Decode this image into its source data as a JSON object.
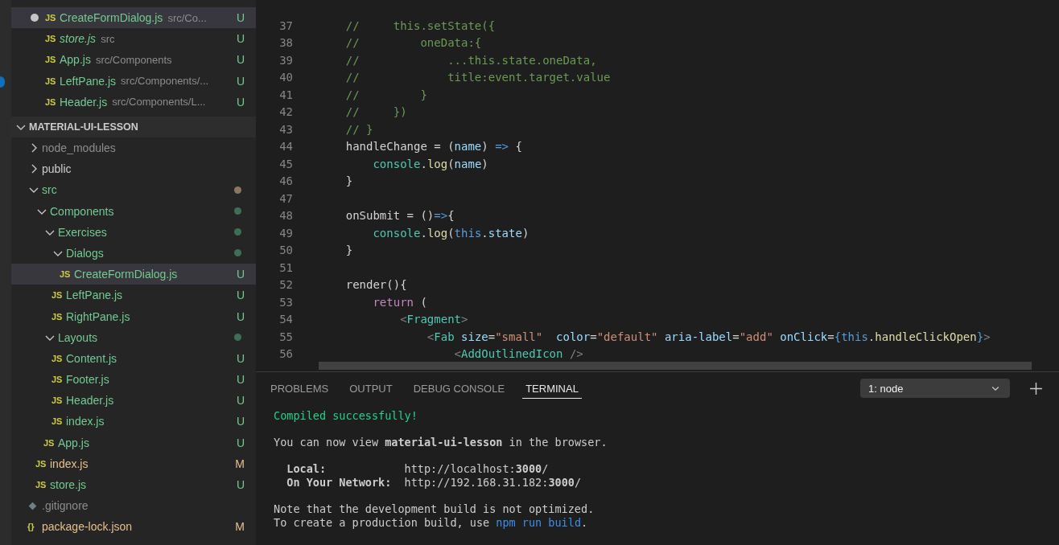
{
  "open_editors": [
    {
      "name": "CreateFormDialog.js",
      "path": "src/Co...",
      "icon": "JS",
      "status": "U",
      "unsaved": true,
      "preview": false,
      "selected": true
    },
    {
      "name": "store.js",
      "path": "src",
      "icon": "JS",
      "status": "U",
      "unsaved": false,
      "preview": true,
      "selected": false
    },
    {
      "name": "App.js",
      "path": "src/Components",
      "icon": "JS",
      "status": "U",
      "unsaved": false,
      "preview": false,
      "selected": false
    },
    {
      "name": "LeftPane.js",
      "path": "src/Components/...",
      "icon": "JS",
      "status": "U",
      "unsaved": false,
      "preview": false,
      "selected": false
    },
    {
      "name": "Header.js",
      "path": "src/Components/L...",
      "icon": "JS",
      "status": "U",
      "unsaved": false,
      "preview": false,
      "selected": false
    }
  ],
  "explorer": {
    "title": "MATERIAL-UI-LESSON",
    "expanded": true,
    "children": [
      {
        "kind": "folder",
        "name": "node_modules",
        "expanded": false,
        "ignored": true,
        "selected": false
      },
      {
        "kind": "folder",
        "name": "public",
        "expanded": false,
        "ignored": false,
        "selected": false
      },
      {
        "kind": "folder",
        "name": "src",
        "expanded": true,
        "color": "#8a7760",
        "ignored": false,
        "selected": false,
        "children": [
          {
            "kind": "folder",
            "name": "Components",
            "expanded": true,
            "color": "#3f6e58",
            "ignored": false,
            "selected": false,
            "children": [
              {
                "kind": "folder",
                "name": "Exercises",
                "expanded": true,
                "color": "#3f6e58",
                "ignored": false,
                "selected": false,
                "children": [
                  {
                    "kind": "folder",
                    "name": "Dialogs",
                    "expanded": true,
                    "color": "#3f6e58",
                    "ignored": false,
                    "selected": false,
                    "children": [
                      {
                        "kind": "file",
                        "name": "CreateFormDialog.js",
                        "icon": "JS",
                        "status": "U",
                        "ignored": false,
                        "selected": true
                      }
                    ]
                  },
                  {
                    "kind": "file",
                    "name": "LeftPane.js",
                    "icon": "JS",
                    "status": "U",
                    "ignored": false,
                    "selected": false
                  },
                  {
                    "kind": "file",
                    "name": "RightPane.js",
                    "icon": "JS",
                    "status": "U",
                    "ignored": false,
                    "selected": false
                  }
                ]
              },
              {
                "kind": "folder",
                "name": "Layouts",
                "expanded": true,
                "color": "#3f6e58",
                "ignored": false,
                "selected": false,
                "children": [
                  {
                    "kind": "file",
                    "name": "Content.js",
                    "icon": "JS",
                    "status": "U",
                    "ignored": false,
                    "selected": false
                  },
                  {
                    "kind": "file",
                    "name": "Footer.js",
                    "icon": "JS",
                    "status": "U",
                    "ignored": false,
                    "selected": false
                  },
                  {
                    "kind": "file",
                    "name": "Header.js",
                    "icon": "JS",
                    "status": "U",
                    "ignored": false,
                    "selected": false
                  },
                  {
                    "kind": "file",
                    "name": "index.js",
                    "icon": "JS",
                    "status": "U",
                    "ignored": false,
                    "selected": false
                  }
                ]
              },
              {
                "kind": "file",
                "name": "App.js",
                "icon": "JS",
                "status": "U",
                "ignored": false,
                "selected": false
              }
            ]
          },
          {
            "kind": "file",
            "name": "index.js",
            "icon": "JS",
            "status": "M",
            "ignored": false,
            "selected": false
          },
          {
            "kind": "file",
            "name": "store.js",
            "icon": "JS",
            "status": "U",
            "ignored": false,
            "selected": false
          }
        ]
      },
      {
        "kind": "file",
        "name": ".gitignore",
        "ignored": true,
        "selected": false
      },
      {
        "kind": "file",
        "name": "package-lock.json",
        "icon": "{}",
        "status": "M",
        "ignored": false,
        "selected": false
      }
    ]
  },
  "editor": {
    "lines": [
      {
        "number": "37",
        "tokens": [
          {
            "kind": "comment",
            "text": "    //     this.setState({"
          }
        ]
      },
      {
        "number": "38",
        "tokens": [
          {
            "kind": "comment",
            "text": "    //         oneData:{"
          }
        ]
      },
      {
        "number": "39",
        "tokens": [
          {
            "kind": "comment",
            "text": "    //             ...this.state.oneData,"
          }
        ]
      },
      {
        "number": "40",
        "tokens": [
          {
            "kind": "comment",
            "text": "    //             title:event.target.value"
          }
        ]
      },
      {
        "number": "41",
        "tokens": [
          {
            "kind": "comment",
            "text": "    //         }"
          }
        ]
      },
      {
        "number": "42",
        "tokens": [
          {
            "kind": "comment",
            "text": "    //     })"
          }
        ]
      },
      {
        "number": "43",
        "tokens": [
          {
            "kind": "comment",
            "text": "    // }"
          }
        ]
      },
      {
        "number": "44",
        "tokens": [
          {
            "kind": "plain",
            "text": "    handleChange = ("
          },
          {
            "kind": "param",
            "text": "name"
          },
          {
            "kind": "plain",
            "text": ") "
          },
          {
            "kind": "keyword",
            "text": "=>"
          },
          {
            "kind": "plain",
            "text": " {"
          }
        ]
      },
      {
        "number": "45",
        "tokens": [
          {
            "kind": "type",
            "text": "        console"
          },
          {
            "kind": "plain",
            "text": "."
          },
          {
            "kind": "fn",
            "text": "log"
          },
          {
            "kind": "plain",
            "text": "("
          },
          {
            "kind": "param",
            "text": "name"
          },
          {
            "kind": "plain",
            "text": ")"
          }
        ]
      },
      {
        "number": "46",
        "tokens": [
          {
            "kind": "plain",
            "text": "    }"
          }
        ]
      },
      {
        "number": "47"
      },
      {
        "number": "48",
        "tokens": [
          {
            "kind": "plain",
            "text": "    onSubmit = ()"
          },
          {
            "kind": "keyword",
            "text": "=>"
          },
          {
            "kind": "plain",
            "text": "{"
          }
        ]
      },
      {
        "number": "49",
        "tokens": [
          {
            "kind": "type",
            "text": "        console"
          },
          {
            "kind": "plain",
            "text": "."
          },
          {
            "kind": "fn",
            "text": "log"
          },
          {
            "kind": "plain",
            "text": "("
          },
          {
            "kind": "keyword",
            "text": "this"
          },
          {
            "kind": "plain",
            "text": "."
          },
          {
            "kind": "param",
            "text": "state"
          },
          {
            "kind": "plain",
            "text": ")"
          }
        ]
      },
      {
        "number": "50",
        "tokens": [
          {
            "kind": "plain",
            "text": "    }"
          }
        ]
      },
      {
        "number": "51"
      },
      {
        "number": "52",
        "tokens": [
          {
            "kind": "plain",
            "text": "    render(){"
          }
        ]
      },
      {
        "number": "53",
        "tokens": [
          {
            "kind": "control",
            "text": "        return"
          },
          {
            "kind": "plain",
            "text": " ("
          }
        ]
      },
      {
        "number": "54",
        "tokens": [
          {
            "kind": "punct",
            "text": "            <"
          },
          {
            "kind": "type",
            "text": "Fragment"
          },
          {
            "kind": "punct",
            "text": ">"
          }
        ]
      },
      {
        "number": "55",
        "tokens": [
          {
            "kind": "punct",
            "text": "                <"
          },
          {
            "kind": "type",
            "text": "Fab"
          },
          {
            "kind": "param",
            "text": " size"
          },
          {
            "kind": "plain",
            "text": "="
          },
          {
            "kind": "string",
            "text": "\"small\""
          },
          {
            "kind": "param",
            "text": "  color"
          },
          {
            "kind": "plain",
            "text": "="
          },
          {
            "kind": "string",
            "text": "\"default\""
          },
          {
            "kind": "param",
            "text": " aria-label"
          },
          {
            "kind": "plain",
            "text": "="
          },
          {
            "kind": "string",
            "text": "\"add\""
          },
          {
            "kind": "param",
            "text": " onClick"
          },
          {
            "kind": "plain",
            "text": "="
          },
          {
            "kind": "keyword",
            "text": "{this"
          },
          {
            "kind": "plain",
            "text": "."
          },
          {
            "kind": "fn",
            "text": "handleClickOpen"
          },
          {
            "kind": "keyword",
            "text": "}"
          },
          {
            "kind": "punct",
            "text": ">"
          }
        ]
      },
      {
        "number": "56",
        "tokens": [
          {
            "kind": "punct",
            "text": "                    <"
          },
          {
            "kind": "type",
            "text": "AddOutlinedIcon"
          },
          {
            "kind": "punct",
            "text": " />"
          }
        ]
      }
    ]
  },
  "panel": {
    "tabs": [
      {
        "label": "PROBLEMS",
        "selected": false
      },
      {
        "label": "OUTPUT",
        "selected": false
      },
      {
        "label": "DEBUG CONSOLE",
        "selected": false
      },
      {
        "label": "TERMINAL",
        "selected": true
      }
    ],
    "terminal_select": {
      "value": "1: node"
    },
    "terminal": [
      {
        "lines": [
          {
            "segments": [
              {
                "kind": "success",
                "text": "Compiled successfully!"
              }
            ]
          }
        ]
      },
      {
        "lines": [
          {
            "segments": [
              {
                "kind": "plain",
                "text": "You can now view **material-ui-lesson** in the browser."
              }
            ]
          }
        ]
      },
      {
        "lines": [
          {
            "segments": [
              {
                "kind": "label",
                "text": "  Local:            "
              },
              {
                "kind": "plain",
                "text": "http://localhost:**3000**/"
              }
            ]
          },
          {
            "segments": [
              {
                "kind": "label",
                "text": "  On Your Network:  "
              },
              {
                "kind": "plain",
                "text": "http://192.168.31.182:**3000**/"
              }
            ]
          }
        ]
      },
      {
        "lines": [
          {
            "segments": [
              {
                "kind": "plain",
                "text": "Note that the development build is not optimized."
              }
            ]
          },
          {
            "segments": [
              {
                "kind": "plain",
                "text": "To create a production build, use "
              },
              {
                "kind": "link",
                "text": "npm run build"
              },
              {
                "kind": "plain",
                "text": "."
              }
            ]
          }
        ]
      }
    ]
  }
}
